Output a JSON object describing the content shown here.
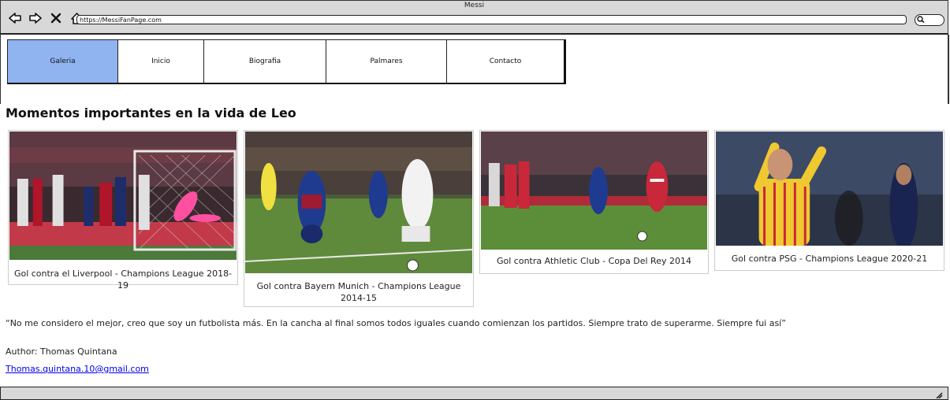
{
  "window": {
    "title": "Messi",
    "url": "https://MessiFanPage.com"
  },
  "nav": {
    "tabs": [
      {
        "label": "Galeria",
        "active": true
      },
      {
        "label": "Inicio",
        "active": false
      },
      {
        "label": "Biografia",
        "active": false
      },
      {
        "label": "Palmares",
        "active": false
      },
      {
        "label": "Contacto",
        "active": false
      }
    ]
  },
  "main": {
    "heading": "Momentos importantes en la vida de Leo",
    "gallery": [
      {
        "caption": "Gol contra el Liverpool - Champions League 2018-19"
      },
      {
        "caption": "Gol contra Bayern Munich - Champions League 2014-15"
      },
      {
        "caption": "Gol contra Athletic Club - Copa Del Rey 2014"
      },
      {
        "caption": "Gol contra PSG - Champions League 2020-21"
      }
    ],
    "quote": "“No me considero el mejor, creo que soy un futbolista más. En la cancha al final somos todos iguales cuando comienzan los partidos. Siempre trato de superarme. Siempre fui así”",
    "author": "Author: Thomas Quintana",
    "email": "Thomas.quintana.10@gmail.com"
  },
  "colors": {
    "active_tab": "#8fb4ef",
    "chrome": "#d8d8d8",
    "link": "#0000ee"
  }
}
